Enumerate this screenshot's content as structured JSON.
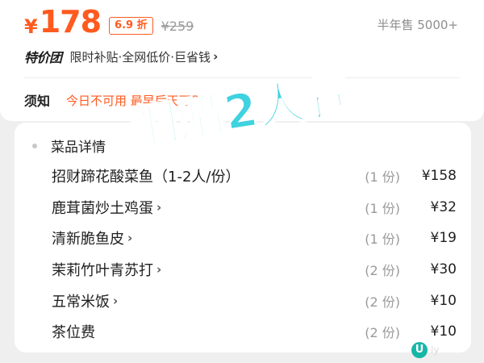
{
  "product": {
    "currency": "¥",
    "price": "178",
    "discount": "6.9 折",
    "original_price": "¥259",
    "sales": "半年售 5000+"
  },
  "promo": {
    "logo": "特价团",
    "text": "限时补贴·全网低价·巨省钱",
    "chevron": "›"
  },
  "notice": {
    "label": "须知",
    "text": "今日不可用 最早后天可用",
    "chevron": "›"
  },
  "menu": {
    "title": "菜品详情",
    "items": [
      {
        "name": "招财蹄花酸菜鱼（1-2人/份）",
        "qty": "(1 份)",
        "price": "¥158",
        "chevron": ""
      },
      {
        "name": "鹿茸菌炒土鸡蛋",
        "qty": "(1 份)",
        "price": "¥32",
        "chevron": "›"
      },
      {
        "name": "清新脆鱼皮",
        "qty": "(1 份)",
        "price": "¥19",
        "chevron": "›"
      },
      {
        "name": "茉莉竹叶青苏打",
        "qty": "(2 份)",
        "price": "¥30",
        "chevron": "›"
      },
      {
        "name": "五常米饭",
        "qty": "(2 份)",
        "price": "¥10",
        "chevron": "›"
      },
      {
        "name": "茶位费",
        "qty": "(2 份)",
        "price": "¥10",
        "chevron": ""
      }
    ]
  },
  "overlay": {
    "title": "網購2人餐",
    "color": "#3fd2e0"
  },
  "watermark": {
    "logo": "U",
    "text": "ly"
  },
  "colors": {
    "accent": "#ff5a1f",
    "background": "#efefef"
  }
}
